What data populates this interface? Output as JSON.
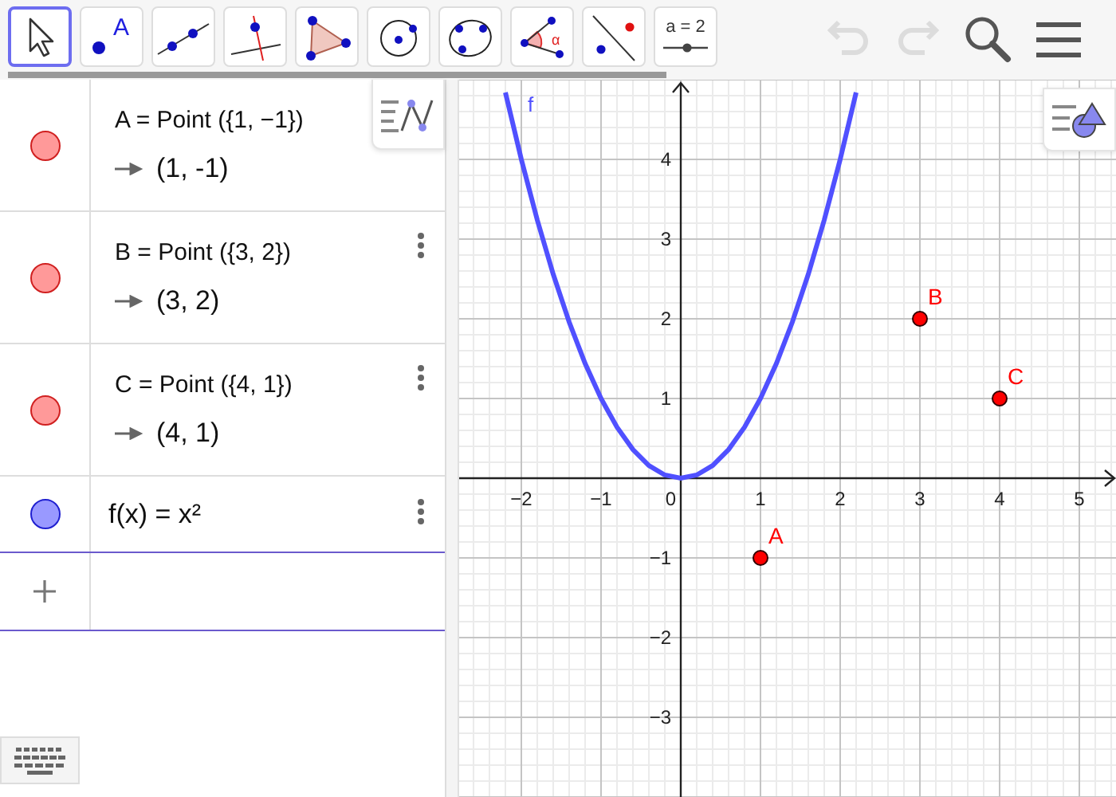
{
  "toolbar": {
    "tools": [
      {
        "kind": "move",
        "selected": true
      },
      {
        "kind": "point",
        "label": "A",
        "selected": false
      },
      {
        "kind": "line",
        "selected": false
      },
      {
        "kind": "perpendicular",
        "selected": false
      },
      {
        "kind": "polygon",
        "selected": false
      },
      {
        "kind": "circle",
        "selected": false
      },
      {
        "kind": "conic",
        "selected": false
      },
      {
        "kind": "angle",
        "label": "α",
        "selected": false
      },
      {
        "kind": "reflect",
        "selected": false
      },
      {
        "kind": "slider",
        "label": "a = 2",
        "selected": false
      }
    ],
    "undo": {
      "disabled": true
    },
    "redo": {
      "disabled": true
    }
  },
  "algebra": {
    "items": [
      {
        "kind": "point",
        "color": "#ff9999",
        "definition": "A = Point ({1, −1})",
        "value": "(1, -1)",
        "menu": false
      },
      {
        "kind": "point",
        "color": "#ff9999",
        "definition": "B = Point ({3, 2})",
        "value": "(3, 2)",
        "menu": true
      },
      {
        "kind": "point",
        "color": "#ff9999",
        "definition": "C = Point ({4, 1})",
        "value": "(4, 1)",
        "menu": true
      },
      {
        "kind": "function",
        "color": "#9999ff",
        "definition": "f(x) = x²",
        "menu": true
      }
    ]
  },
  "graphics": {
    "chart_data": {
      "type": "line",
      "x": [
        -2.2,
        -2,
        -1.8,
        -1.6,
        -1.4,
        -1.2,
        -1,
        -0.8,
        -0.6,
        -0.4,
        -0.2,
        0,
        0.2,
        0.4,
        0.6,
        0.8,
        1,
        1.2,
        1.4,
        1.6,
        1.8,
        2,
        2.2
      ],
      "series": [
        {
          "name": "f",
          "color": "#5050ff",
          "values": [
            4.84,
            4,
            3.24,
            2.56,
            1.96,
            1.44,
            1,
            0.64,
            0.36,
            0.16,
            0.04,
            0,
            0.04,
            0.16,
            0.36,
            0.64,
            1,
            1.44,
            1.96,
            2.56,
            3.24,
            4,
            4.84
          ]
        }
      ],
      "grid": true,
      "xlim": [
        -2.78,
        5.48
      ],
      "ylim": [
        -4,
        5
      ],
      "xticks": [
        {
          "value": -2,
          "label": "−2"
        },
        {
          "value": -1,
          "label": "−1"
        },
        {
          "value": 0,
          "label": "0"
        },
        1,
        2,
        3,
        4,
        5
      ],
      "yticks": [
        {
          "value": -3,
          "label": "−3"
        },
        {
          "value": -2,
          "label": "−2"
        },
        {
          "value": -1,
          "label": "−1"
        },
        1,
        2,
        3,
        4
      ],
      "annotations": [
        {
          "text": "A",
          "x": 1,
          "y": -1
        },
        {
          "text": "B",
          "x": 3,
          "y": 2
        },
        {
          "text": "C",
          "x": 4,
          "y": 1
        }
      ]
    }
  }
}
